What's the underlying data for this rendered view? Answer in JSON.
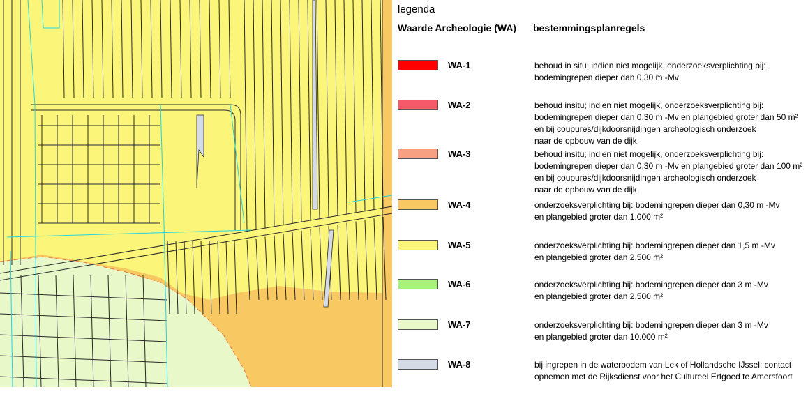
{
  "legend": {
    "title": "legenda",
    "header_left": "Waarde Archeologie (WA)",
    "header_right": "bestemmingsplanregels",
    "entries": [
      {
        "code": "WA-1",
        "color": "#ff0000",
        "lines": [
          "behoud in situ; indien niet mogelijk, onderzoeksverplichting bij:",
          "bodemingrepen dieper dan 0,30 m -Mv"
        ]
      },
      {
        "code": "WA-2",
        "color": "#f65a6a",
        "lines": [
          "behoud insitu; indien niet mogelijk, onderzoeksverplichting bij:",
          "bodemingrepen dieper dan 0,30 m -Mv en plangebied groter dan 50 m²",
          "en bij coupures/dijkdoorsnijdingen archeologisch onderzoek",
          "naar de opbouw van de dijk"
        ]
      },
      {
        "code": "WA-3",
        "color": "#f8a082",
        "lines": [
          "behoud insitu; indien niet mogelijk, onderzoeksverplichting bij:",
          "bodemingrepen dieper dan 0,30 m -Mv en plangebied groter dan 100 m²",
          "en bij coupures/dijkdoorsnijdingen archeologisch onderzoek",
          "naar de opbouw van de dijk"
        ]
      },
      {
        "code": "WA-4",
        "color": "#f8c862",
        "lines": [
          "onderzoeksverplichting bij: bodemingrepen dieper dan 0,30 m -Mv",
          "en plangebied groter dan 1.000 m²"
        ]
      },
      {
        "code": "WA-5",
        "color": "#fbf67a",
        "lines": [
          "onderzoeksverplichting bij: bodemingrepen dieper dan 1,5 m -Mv",
          "en plangebied groter dan 2.500 m²"
        ]
      },
      {
        "code": "WA-6",
        "color": "#a8f27a",
        "lines": [
          "onderzoeksverplichting bij: bodemingrepen dieper dan 3 m -Mv",
          "en plangebied groter dan 2.500 m²"
        ]
      },
      {
        "code": "WA-7",
        "color": "#e8f8c8",
        "lines": [
          "onderzoeksverplichting bij: bodemingrepen dieper dan 3 m -Mv",
          "en plangebied groter dan 10.000 m²"
        ]
      },
      {
        "code": "WA-8",
        "color": "#d4dbe6",
        "lines": [
          "bij ingrepen in de waterbodem van Lek of Hollandsche IJssel: contact",
          "opnemen met de Rijksdienst voor het Cultureel Erfgoed te Amersfoort"
        ]
      }
    ]
  },
  "map": {
    "colors": {
      "wa5": "#fbf67a",
      "wa4": "#f8c862",
      "wa7": "#e8f8c8",
      "wa8": "#d4dbe6",
      "line": "#2a2a2a",
      "cyan": "#21d4e0",
      "boundary": "#e87a3a"
    }
  }
}
